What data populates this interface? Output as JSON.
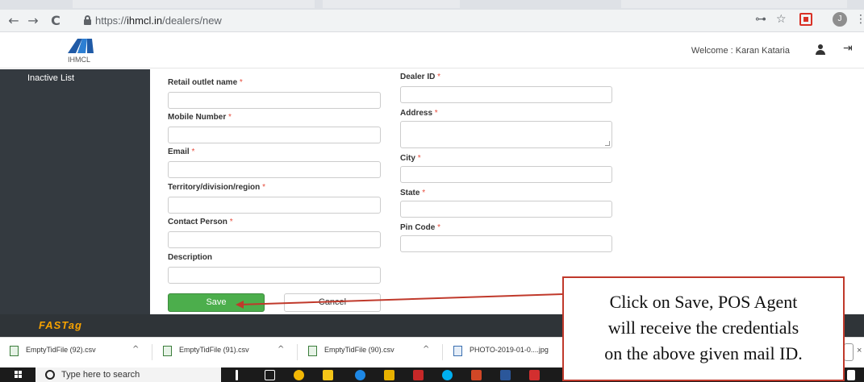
{
  "browser": {
    "url_prefix": "https://",
    "url_host": "ihmcl.in",
    "url_path": "/dealers/new",
    "back_glyph": "←",
    "forward_glyph": "→",
    "reload_glyph": "C",
    "key_glyph": "⊶",
    "star_glyph": "☆",
    "profile_initial": "J",
    "menu_glyph": "⋮"
  },
  "header": {
    "logo_text": "IHMCL",
    "welcome": "Welcome : Karan Kataria",
    "logout_glyph": "⇥"
  },
  "sidebar": {
    "items": [
      {
        "label": "Inactive List"
      }
    ]
  },
  "form": {
    "required_mark": "*",
    "left_fields": [
      {
        "label": "Retail outlet name",
        "required": true
      },
      {
        "label": "Mobile Number",
        "required": true
      },
      {
        "label": "Email",
        "required": true
      },
      {
        "label": "Territory/division/region",
        "required": true
      },
      {
        "label": "Contact Person",
        "required": true
      },
      {
        "label": "Description",
        "required": false
      }
    ],
    "right_fields": [
      {
        "label": "Dealer ID",
        "required": true
      },
      {
        "label": "Address",
        "required": true
      },
      {
        "label": "City",
        "required": true
      },
      {
        "label": "State",
        "required": true
      },
      {
        "label": "Pin Code",
        "required": true
      }
    ],
    "save_label": "Save",
    "cancel_label": "Cancel"
  },
  "footer": {
    "brand": "FASTag"
  },
  "downloads": {
    "items": [
      {
        "name": "EmptyTidFile (92).csv"
      },
      {
        "name": "EmptyTidFile (91).csv"
      },
      {
        "name": "EmptyTidFile (90).csv"
      },
      {
        "name": "PHOTO-2019-01-0....jpg"
      }
    ],
    "chevron": "^",
    "close": "×"
  },
  "taskbar": {
    "search_placeholder": "Type here to search"
  },
  "callout": {
    "lines": [
      "Click on Save, POS Agent",
      "will receive the credentials",
      "on the above given mail ID."
    ],
    "border_color": "#c0392b"
  }
}
